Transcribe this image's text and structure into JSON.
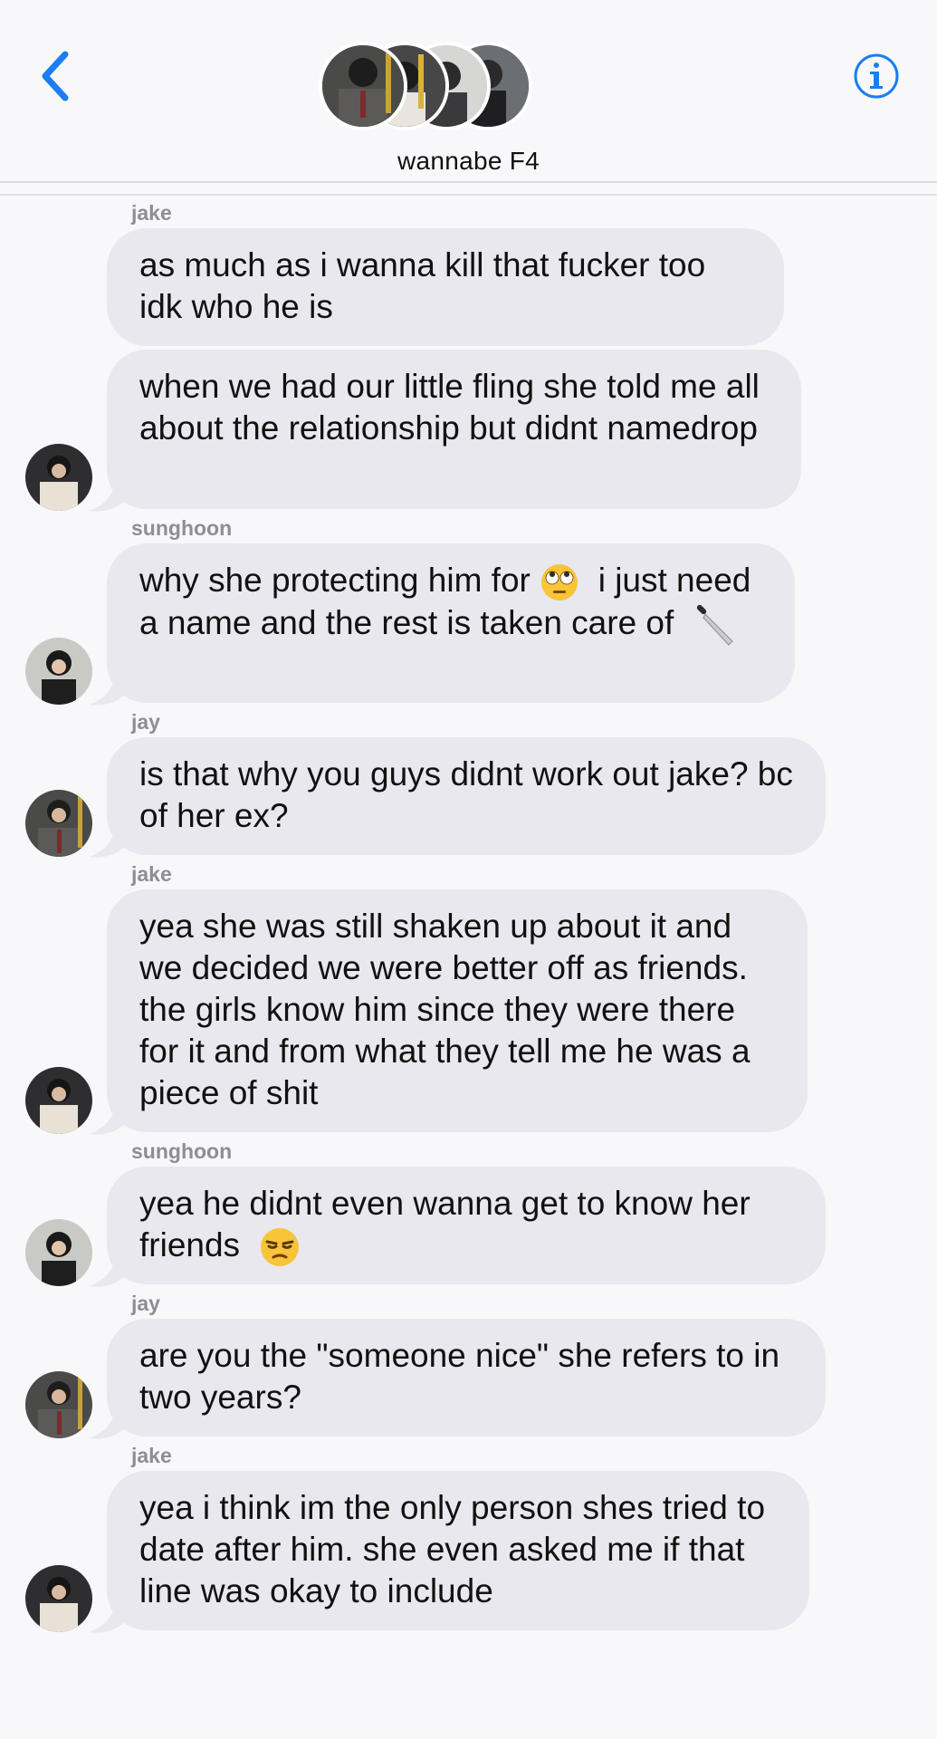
{
  "header": {
    "group_name": "wannabe F4",
    "back_icon": "chevron-left-icon",
    "info_icon": "info-icon",
    "accent": "#1a7ef0"
  },
  "messages": [
    {
      "sender": "jake",
      "text": "as much as i wanna kill that fucker too idk who he is"
    },
    {
      "sender": "",
      "text": "when we had our little fling she told me all about the relationship but didnt namedrop"
    },
    {
      "sender": "sunghoon",
      "text": "why she protecting him for",
      "emoji_1": "face-with-rolling-eyes",
      "text_2": " i just need a name and the rest is taken care of ",
      "emoji_2": "kitchen-knife"
    },
    {
      "sender": "jay",
      "text": "is that why you guys didnt work out jake? bc of her ex?"
    },
    {
      "sender": "jake",
      "text": "yea she was still shaken up about it and we decided we were better off as friends. the girls know him since they were there for it and from what they tell me he was a piece of shit"
    },
    {
      "sender": "sunghoon",
      "text": "yea he didnt even wanna get to know her friends ",
      "emoji_1": "unamused-face"
    },
    {
      "sender": "jay",
      "text": "are you the \"someone nice\" she refers to in two years?"
    },
    {
      "sender": "jake",
      "text": "yea i think im the only person shes tried to date after him. she even asked me if that line was okay to include"
    }
  ],
  "colors": {
    "bubble_incoming": "#e8e8ee",
    "background": "#f8f8fa",
    "sender_label": "#8e8e93"
  }
}
